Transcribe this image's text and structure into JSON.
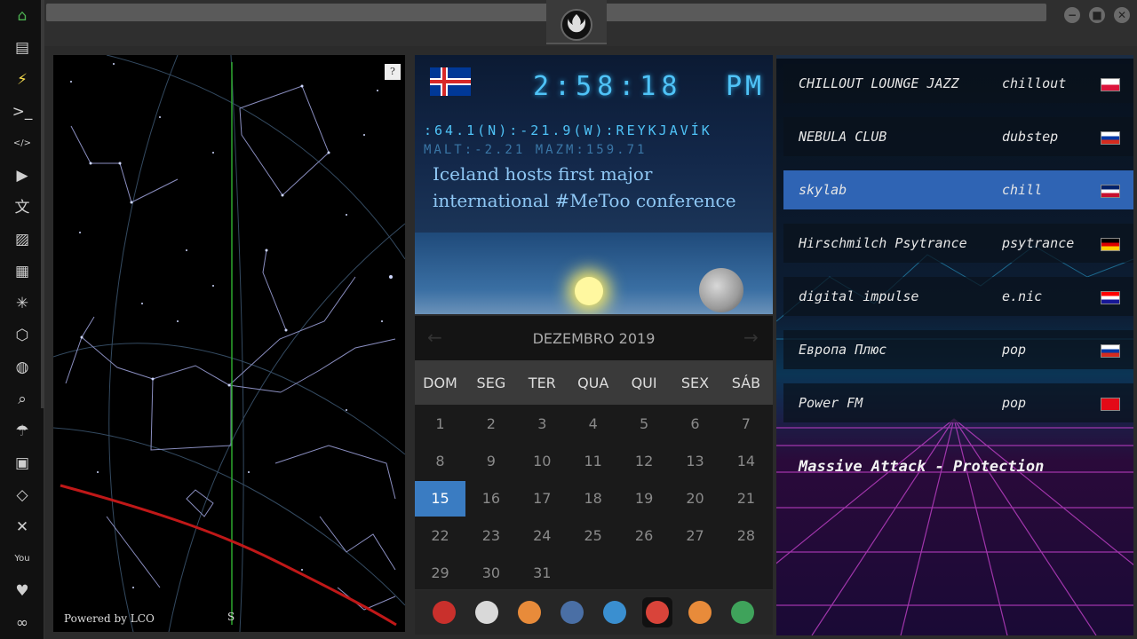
{
  "sidebar": {
    "items": [
      {
        "name": "home-icon",
        "glyph": "⌂",
        "color": "#4caf50"
      },
      {
        "name": "document-icon",
        "glyph": "▤",
        "color": "#cfcfcf"
      },
      {
        "name": "lightning-icon",
        "glyph": "⚡",
        "color": "#f2d84c"
      },
      {
        "name": "terminal-icon",
        "glyph": ">_",
        "color": "#cfcfcf"
      },
      {
        "name": "code-icon",
        "glyph": "</>",
        "color": "#cfcfcf"
      },
      {
        "name": "play-icon",
        "glyph": "▶",
        "color": "#cfcfcf"
      },
      {
        "name": "translate-icon",
        "glyph": "文",
        "color": "#cfcfcf"
      },
      {
        "name": "image-icon",
        "glyph": "▨",
        "color": "#cfcfcf"
      },
      {
        "name": "news-icon",
        "glyph": "▦",
        "color": "#cfcfcf"
      },
      {
        "name": "rebel-icon",
        "glyph": "✳",
        "color": "#cfcfcf"
      },
      {
        "name": "hexagon-icon",
        "glyph": "⬡",
        "color": "#cfcfcf"
      },
      {
        "name": "globe-icon",
        "glyph": "◍",
        "color": "#cfcfcf"
      },
      {
        "name": "search-icon",
        "glyph": "⌕",
        "color": "#cfcfcf"
      },
      {
        "name": "umbrella-icon",
        "glyph": "☂",
        "color": "#cfcfcf"
      },
      {
        "name": "contact-icon",
        "glyph": "▣",
        "color": "#cfcfcf"
      },
      {
        "name": "link-icon",
        "glyph": "◇",
        "color": "#cfcfcf"
      },
      {
        "name": "expand-icon",
        "glyph": "✕",
        "color": "#cfcfcf"
      },
      {
        "name": "youtube-icon",
        "glyph": "You",
        "color": "#cfcfcf"
      },
      {
        "name": "heart-icon",
        "glyph": "♥",
        "color": "#cfcfcf"
      },
      {
        "name": "infinity-icon",
        "glyph": "∞",
        "color": "#cfcfcf"
      }
    ]
  },
  "window": {
    "minimize": "−",
    "maximize": "■",
    "close": "✕"
  },
  "skymap": {
    "help": "?",
    "powered_by": "Powered by LCO",
    "direction": "S"
  },
  "clock": {
    "time": "2:58:18",
    "ampm": "PM",
    "coords": ":64.1(N):-21.9(W):REYKJAVÍK",
    "alt": "MALT:-2.21 MAZM:159.71",
    "headline": "Iceland hosts first major international #MeToo conference"
  },
  "calendar": {
    "prev": "←",
    "next": "→",
    "month": "DEZEMBRO 2019",
    "dows": [
      "DOM",
      "SEG",
      "TER",
      "QUA",
      "QUI",
      "SEX",
      "SÁB"
    ],
    "weeks": [
      [
        "1",
        "2",
        "3",
        "4",
        "5",
        "6",
        "7"
      ],
      [
        "8",
        "9",
        "10",
        "11",
        "12",
        "13",
        "14"
      ],
      [
        "15",
        "16",
        "17",
        "18",
        "19",
        "20",
        "21"
      ],
      [
        "22",
        "23",
        "24",
        "25",
        "26",
        "27",
        "28"
      ],
      [
        "29",
        "30",
        "31"
      ]
    ],
    "today": "15",
    "today_color": "#3a7cc2"
  },
  "dock": {
    "items": [
      {
        "name": "arch-icon",
        "color": "#c9302c"
      },
      {
        "name": "newspaper-icon",
        "color": "#d9d9d9"
      },
      {
        "name": "search-app-icon",
        "color": "#e88b3a"
      },
      {
        "name": "clock-app-icon",
        "color": "#4a6fa5"
      },
      {
        "name": "globe-app-icon",
        "color": "#3a8fd0"
      },
      {
        "name": "calendar-app-icon",
        "color": "#d9443a"
      },
      {
        "name": "arrow-app-icon",
        "color": "#e88b3a"
      },
      {
        "name": "yandex-app-icon",
        "color": "#3fa35b"
      }
    ]
  },
  "radio": {
    "stations": [
      {
        "name": "CHILLOUT LOUNGE JAZZ",
        "genre": "chillout",
        "flag_colors": [
          "#ffffff",
          "#dc143c"
        ]
      },
      {
        "name": "NEBULA CLUB",
        "genre": "dubstep",
        "flag_colors": [
          "#ffffff",
          "#0039a6",
          "#d52b1e"
        ]
      },
      {
        "name": "skylab",
        "genre": "chill",
        "flag_colors": [
          "#012169",
          "#ffffff",
          "#c8102e"
        ]
      },
      {
        "name": "Hirschmilch Psytrance",
        "genre": "psytrance",
        "flag_colors": [
          "#000000",
          "#dd0000",
          "#ffce00"
        ]
      },
      {
        "name": "digital impulse",
        "genre": "e.nic",
        "flag_colors": [
          "#ff0000",
          "#ffffff",
          "#171796"
        ]
      },
      {
        "name": "Европа Плюс",
        "genre": "pop",
        "flag_colors": [
          "#ffffff",
          "#0039a6",
          "#d52b1e"
        ]
      },
      {
        "name": "Power FM",
        "genre": "pop",
        "flag_colors": [
          "#e30a17",
          "#e30a17",
          "#e30a17"
        ]
      }
    ],
    "active_index": 2,
    "now_playing": "Massive Attack - Protection"
  }
}
